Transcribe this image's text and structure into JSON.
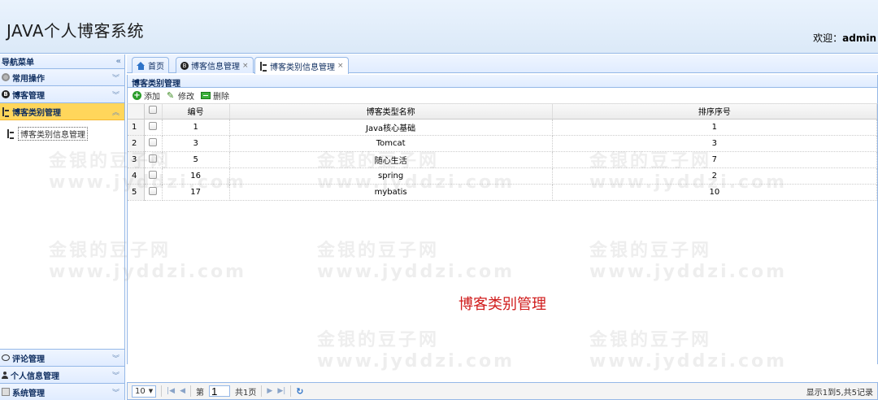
{
  "header": {
    "title": "JAVA个人博客系统",
    "welcome_label": "欢迎：",
    "user": "admin"
  },
  "sidebar": {
    "heading": "导航菜单",
    "collapse_icon": "«",
    "top_items": [
      {
        "label": "常用操作",
        "icon": "gear-icon"
      },
      {
        "label": "博客管理",
        "icon": "blog-icon"
      },
      {
        "label": "博客类别管理",
        "icon": "tree-icon",
        "active": true
      }
    ],
    "tree_items": [
      {
        "label": "博客类别信息管理"
      }
    ],
    "bottom_items": [
      {
        "label": "评论管理",
        "icon": "chat-icon"
      },
      {
        "label": "个人信息管理",
        "icon": "user-icon"
      },
      {
        "label": "系统管理",
        "icon": "system-icon"
      }
    ]
  },
  "tabs": [
    {
      "label": "首页",
      "closable": false
    },
    {
      "label": "博客信息管理",
      "closable": true
    },
    {
      "label": "博客类别信息管理",
      "closable": true,
      "selected": true
    }
  ],
  "panel": {
    "title": "博客类别管理"
  },
  "toolbar": {
    "add": "添加",
    "edit": "修改",
    "delete": "删除"
  },
  "table": {
    "columns": [
      "编号",
      "博客类型名称",
      "排序序号"
    ],
    "rows": [
      {
        "n": "1",
        "id": "1",
        "name": "Java核心基础",
        "order": "1"
      },
      {
        "n": "2",
        "id": "3",
        "name": "Tomcat",
        "order": "3"
      },
      {
        "n": "3",
        "id": "5",
        "name": "随心生活",
        "order": "7"
      },
      {
        "n": "4",
        "id": "16",
        "name": "spring",
        "order": "2"
      },
      {
        "n": "5",
        "id": "17",
        "name": "mybatis",
        "order": "10"
      }
    ]
  },
  "center_label": "博客类别管理",
  "pager": {
    "page_size": "10",
    "page_prefix": "第",
    "page_value": "1",
    "page_suffix": "共1页",
    "info": "显示1到5,共5记录"
  },
  "watermark": {
    "line1": "金银的豆子网",
    "line2": "www.jyddzi.com"
  },
  "colors": {
    "accent": "#95b8e7",
    "active_menu": "#ffd65b",
    "center_label": "#d01c1c"
  }
}
